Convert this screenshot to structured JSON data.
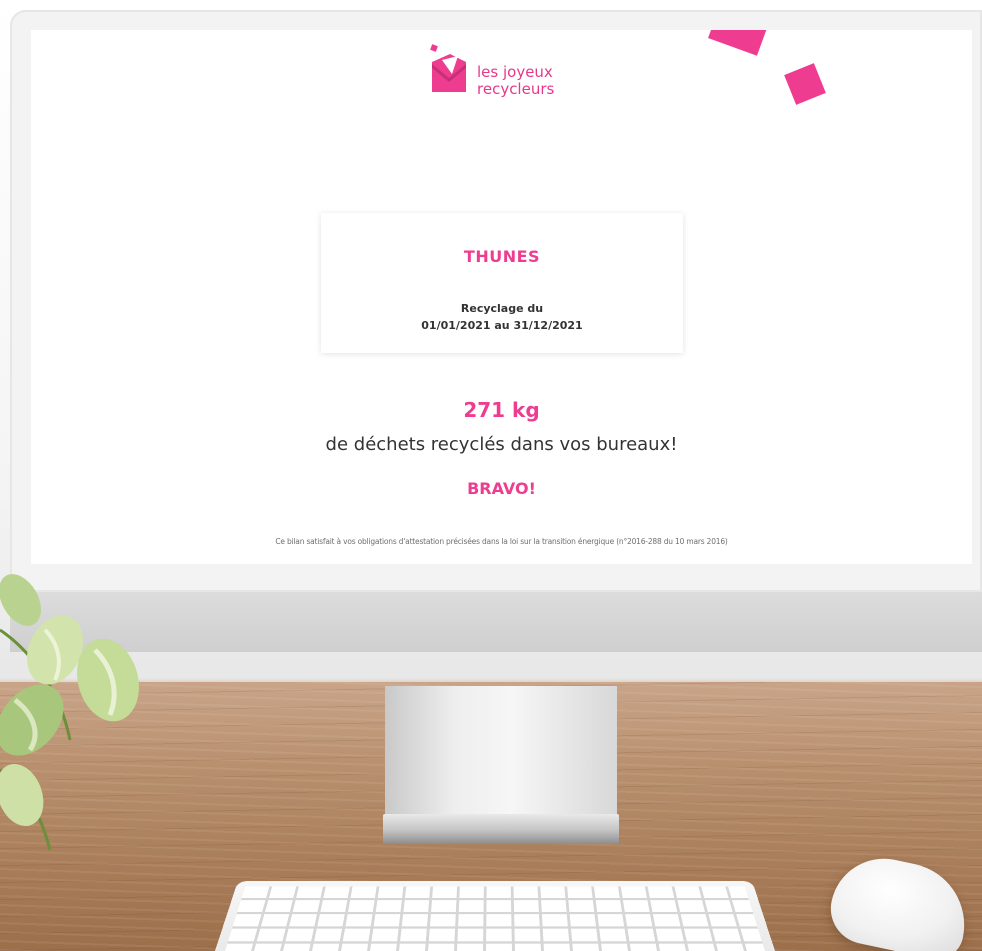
{
  "brand": {
    "name_line1": "les joyeux",
    "name_line2": "recycleurs",
    "accent_color": "#ee3d90"
  },
  "card": {
    "client_name": "THUNES",
    "period_label": "Recyclage du",
    "period_dates": "01/01/2021 au 31/12/2021"
  },
  "summary": {
    "amount": "271 kg",
    "description": "de déchets recyclés dans vos bureaux!",
    "congrats": "BRAVO!"
  },
  "footnote": "Ce bilan satisfait à vos obligations d'attestation précisées dans la loi sur la transition énergique (n°2016-288 du 10 mars 2016)",
  "icons": {
    "logo": "recycling-envelope-logo-icon",
    "deco": "pink-square-icon"
  }
}
